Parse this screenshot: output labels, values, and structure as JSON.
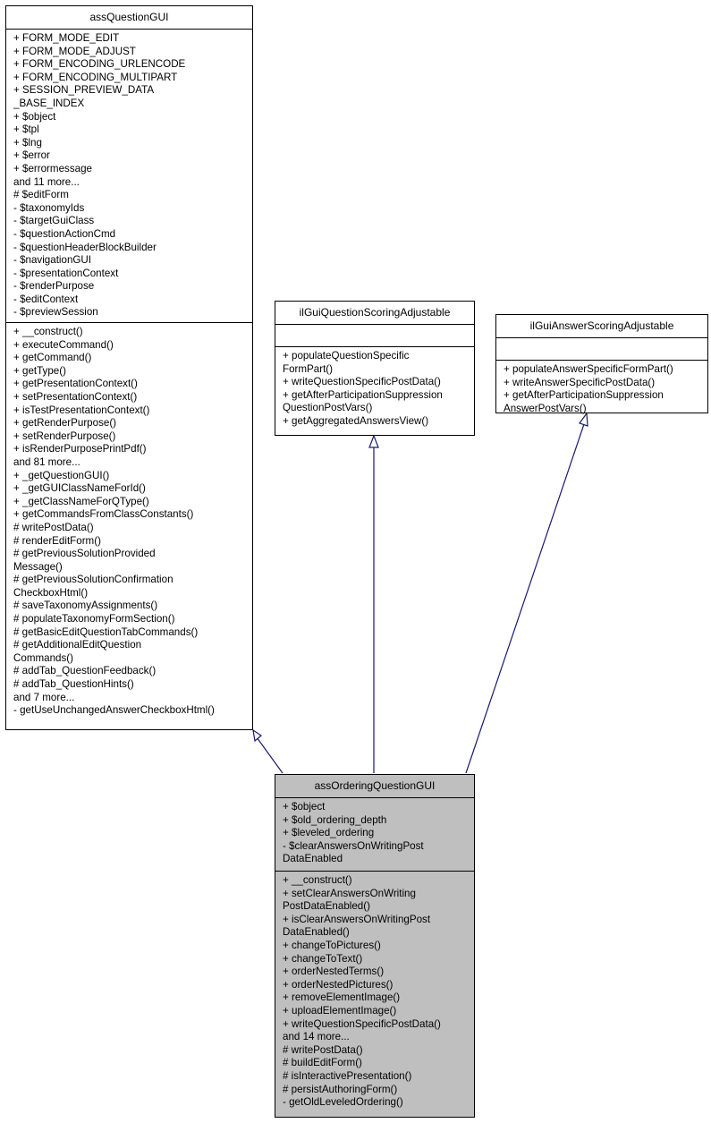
{
  "classes": {
    "base": {
      "name": "assQuestionGUI",
      "attributes": [
        "+ FORM_MODE_EDIT",
        "+ FORM_MODE_ADJUST",
        "+ FORM_ENCODING_URLENCODE",
        "+ FORM_ENCODING_MULTIPART",
        "+ SESSION_PREVIEW_DATA",
        "_BASE_INDEX",
        "+ $object",
        "+ $tpl",
        "+ $lng",
        "+ $error",
        "+ $errormessage",
        "and 11 more...",
        "# $editForm",
        "- $taxonomyIds",
        "- $targetGuiClass",
        "- $questionActionCmd",
        "- $questionHeaderBlockBuilder",
        "- $navigationGUI",
        "- $presentationContext",
        "- $renderPurpose",
        "- $editContext",
        "- $previewSession"
      ],
      "methods": [
        "+ __construct()",
        "+ executeCommand()",
        "+ getCommand()",
        "+ getType()",
        "+ getPresentationContext()",
        "+ setPresentationContext()",
        "+ isTestPresentationContext()",
        "+ getRenderPurpose()",
        "+ setRenderPurpose()",
        "+ isRenderPurposePrintPdf()",
        "and 81 more...",
        "+ _getQuestionGUI()",
        "+ _getGUIClassNameForId()",
        "+ _getClassNameForQType()",
        "+ getCommandsFromClassConstants()",
        "# writePostData()",
        "# renderEditForm()",
        "# getPreviousSolutionProvided",
        "Message()",
        "# getPreviousSolutionConfirmation",
        "CheckboxHtml()",
        "# saveTaxonomyAssignments()",
        "# populateTaxonomyFormSection()",
        "# getBasicEditQuestionTabCommands()",
        "# getAdditionalEditQuestion",
        "Commands()",
        "# addTab_QuestionFeedback()",
        "# addTab_QuestionHints()",
        "and 7 more...",
        "- getUseUnchangedAnswerCheckboxHtml()"
      ]
    },
    "question_scoring": {
      "name": "ilGuiQuestionScoringAdjustable",
      "attributes": [],
      "methods": [
        "+ populateQuestionSpecific",
        "FormPart()",
        "+ writeQuestionSpecificPostData()",
        "+ getAfterParticipationSuppression",
        "QuestionPostVars()",
        "+ getAggregatedAnswersView()"
      ]
    },
    "answer_scoring": {
      "name": "ilGuiAnswerScoringAdjustable",
      "attributes": [],
      "methods": [
        "+ populateAnswerSpecificFormPart()",
        "+ writeAnswerSpecificPostData()",
        "+ getAfterParticipationSuppression",
        "AnswerPostVars()"
      ]
    },
    "ordering": {
      "name": "assOrderingQuestionGUI",
      "attributes": [
        "+ $object",
        "+ $old_ordering_depth",
        "+ $leveled_ordering",
        "- $clearAnswersOnWritingPost",
        "DataEnabled"
      ],
      "methods": [
        "+ __construct()",
        "+ setClearAnswersOnWriting",
        "PostDataEnabled()",
        "+ isClearAnswersOnWritingPost",
        "DataEnabled()",
        "+ changeToPictures()",
        "+ changeToText()",
        "+ orderNestedTerms()",
        "+ orderNestedPictures()",
        "+ removeElementImage()",
        "+ uploadElementImage()",
        "+ writeQuestionSpecificPostData()",
        "and 14 more...",
        "# writePostData()",
        "# buildEditForm()",
        "# isInteractivePresentation()",
        "# persistAuthoringForm()",
        "- getOldLeveledOrdering()"
      ]
    }
  },
  "relations": [
    {
      "from": "assOrderingQuestionGUI",
      "to": "assQuestionGUI",
      "type": "inheritance"
    },
    {
      "from": "assOrderingQuestionGUI",
      "to": "ilGuiQuestionScoringAdjustable",
      "type": "inheritance"
    },
    {
      "from": "assOrderingQuestionGUI",
      "to": "ilGuiAnswerScoringAdjustable",
      "type": "inheritance"
    }
  ],
  "colors": {
    "edge": "#191970",
    "highlight_fill": "#bfbfbf",
    "border": "#000000"
  }
}
